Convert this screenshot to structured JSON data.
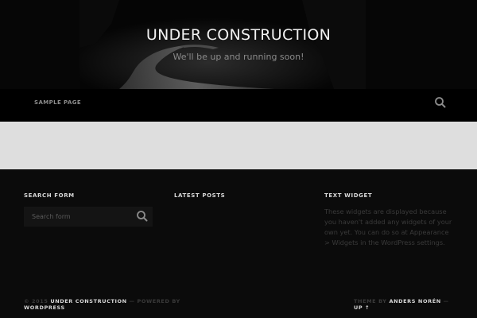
{
  "header": {
    "site_title": "UNDER CONSTRUCTION",
    "tagline": "We'll be up and running soon!"
  },
  "nav": {
    "items": [
      {
        "label": "SAMPLE PAGE"
      }
    ],
    "search_icon": "search-icon"
  },
  "footer": {
    "widgets": {
      "search": {
        "title": "SEARCH FORM",
        "placeholder": "Search form",
        "button_icon": "search-icon"
      },
      "latest_posts": {
        "title": "LATEST POSTS"
      },
      "text": {
        "title": "TEXT WIDGET",
        "body": "These widgets are displayed because you haven't added any widgets of your own yet. You can do so at Appearance > Widgets in the WordPress settings."
      }
    },
    "credits": {
      "copyright_prefix": "© 2015 ",
      "site_link": "UNDER CONSTRUCTION",
      "powered_prefix": " — POWERED BY ",
      "powered_link": "WORDPRESS",
      "theme_prefix": "THEME BY ",
      "author_link": "ANDERS NORÉN",
      "separator": " — ",
      "up_link": "UP ↑"
    }
  },
  "colors": {
    "background": "#0b0b0b",
    "band": "#dedede",
    "muted_text": "#3a3a3a",
    "title_text": "#f2f2f2"
  }
}
